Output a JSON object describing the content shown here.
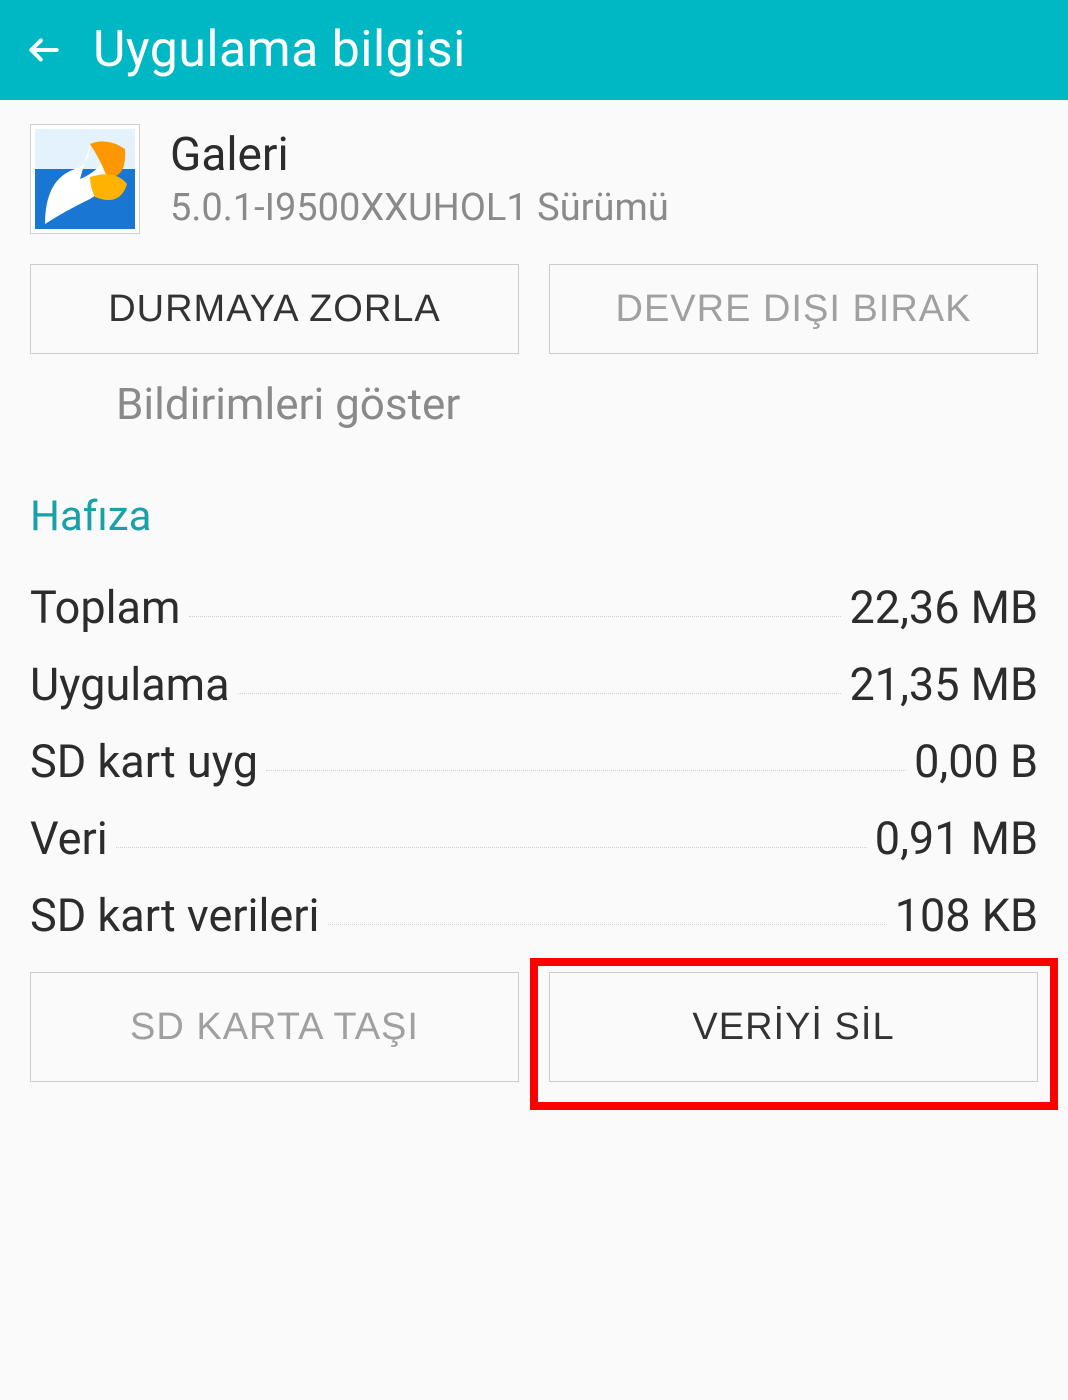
{
  "header": {
    "title": "Uygulama bilgisi"
  },
  "app": {
    "name": "Galeri",
    "version": "5.0.1-I9500XXUHOL1 Sürümü"
  },
  "buttons": {
    "force_stop": "DURMAYA ZORLA",
    "disable": "DEVRE DIŞI BIRAK",
    "move_to_sd": "SD KARTA TAŞI",
    "delete_data": "VERİYİ SİL"
  },
  "checkbox": {
    "show_notifications": "Bildirimleri göster"
  },
  "section": {
    "memory": "Hafıza"
  },
  "stats": {
    "items": [
      {
        "label": "Toplam",
        "value": "22,36 MB"
      },
      {
        "label": "Uygulama",
        "value": "21,35 MB"
      },
      {
        "label": "SD kart uyg",
        "value": "0,00 B"
      },
      {
        "label": "Veri",
        "value": "0,91 MB"
      },
      {
        "label": "SD kart verileri",
        "value": "108 KB"
      }
    ]
  },
  "highlight": {
    "target": "delete-data-button"
  }
}
